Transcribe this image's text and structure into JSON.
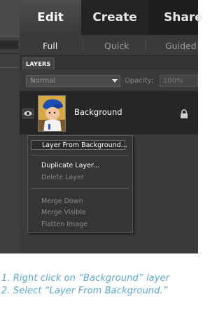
{
  "tabs": {
    "main": [
      "Edit",
      "Create",
      "Share"
    ],
    "active": "Edit",
    "sub": [
      "Full",
      "Quick",
      "Guided"
    ],
    "active_sub": "Full"
  },
  "layers_panel": {
    "title": "LAYERS",
    "blend_mode": "Normal",
    "opacity_label": "Opacity:",
    "opacity_value": "100%",
    "layer_name": "Background",
    "lock_icon": "lock-icon",
    "eye_icon": "eye-icon"
  },
  "context_menu": {
    "items": [
      {
        "label": "Layer From Background...",
        "enabled": true,
        "highlight": true
      },
      {
        "label": "Duplicate Layer...",
        "enabled": true
      },
      {
        "label": "Delete Layer",
        "enabled": false
      },
      {
        "label": "Merge Down",
        "enabled": false
      },
      {
        "label": "Merge Visible",
        "enabled": false
      },
      {
        "label": "Flatten Image",
        "enabled": false
      }
    ]
  },
  "captions": [
    "1. Right click on “Background” layer",
    "2. Select “Layer From Background.”"
  ],
  "colors": {
    "panel_bg": "#3b3b3b",
    "tab_bar": "#1e1e1e",
    "layer_row": "#262626",
    "caption": "#5aa7cf"
  }
}
